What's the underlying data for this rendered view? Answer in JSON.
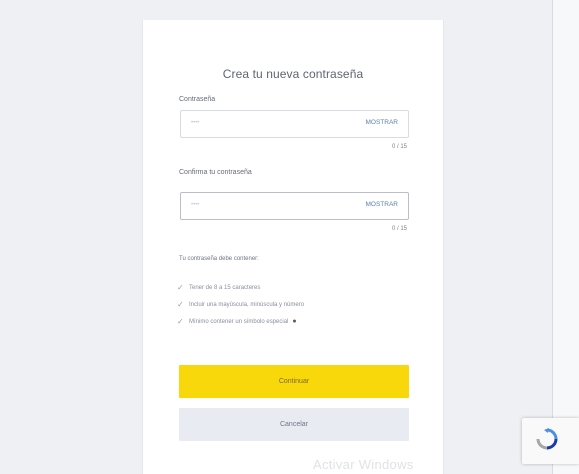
{
  "form": {
    "title": "Crea tu nueva contraseña",
    "password_label": "Contraseña",
    "password_placeholder": "••••",
    "password_show": "MOSTRAR",
    "password_counter": "0 / 15",
    "confirm_label": "Confirma tu contraseña",
    "confirm_placeholder": "••••",
    "confirm_show": "MOSTRAR",
    "confirm_counter": "0 / 15"
  },
  "requirements": {
    "title": "Tu contraseña debe contener:",
    "items": [
      {
        "text": "Tener de 8 a 15 caracteres"
      },
      {
        "text": "Incluir una mayúscula, minúscula y número"
      },
      {
        "text": "Mínimo contener un símbolo especial"
      }
    ]
  },
  "buttons": {
    "continue_label": "Continuar",
    "cancel_label": "Cancelar"
  },
  "overlay": {
    "windows_watermark": "Activar Windows"
  },
  "icons": {
    "check": "check-icon",
    "info": "info-icon",
    "recaptcha": "recaptcha-icon"
  },
  "colors": {
    "primary_button": "#f8d80b",
    "secondary_button": "#e8ebf2",
    "link": "#5b7fb4"
  }
}
